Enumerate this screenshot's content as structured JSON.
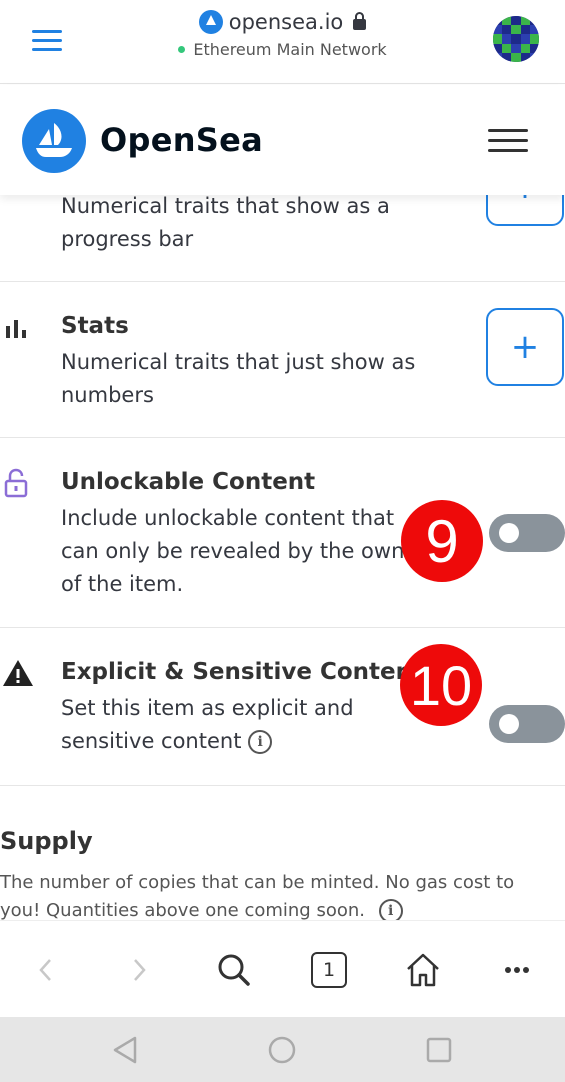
{
  "browser": {
    "domain": "opensea.io",
    "network": "Ethereum Main Network"
  },
  "header": {
    "brand": "OpenSea"
  },
  "rows": {
    "levels": {
      "description": "Numerical traits that show as a progress bar",
      "button_label": "+"
    },
    "stats": {
      "title": "Stats",
      "description": "Numerical traits that just show as numbers",
      "button_label": "+"
    },
    "unlockable": {
      "title": "Unlockable Content",
      "description": "Include unlockable content that can only be revealed by the owner of the item.",
      "toggle_on": false
    },
    "explicit": {
      "title": "Explicit & Sensitive Content",
      "description": "Set this item as explicit and sensitive content",
      "toggle_on": false
    }
  },
  "supply": {
    "title": "Supply",
    "description": "The number of copies that can be minted. No gas cost to you! Quantities above one coming soon."
  },
  "annotations": {
    "badge_9": "9",
    "badge_10": "10"
  },
  "bottom_nav": {
    "tab_count": "1"
  },
  "icons": {
    "info": "i"
  }
}
